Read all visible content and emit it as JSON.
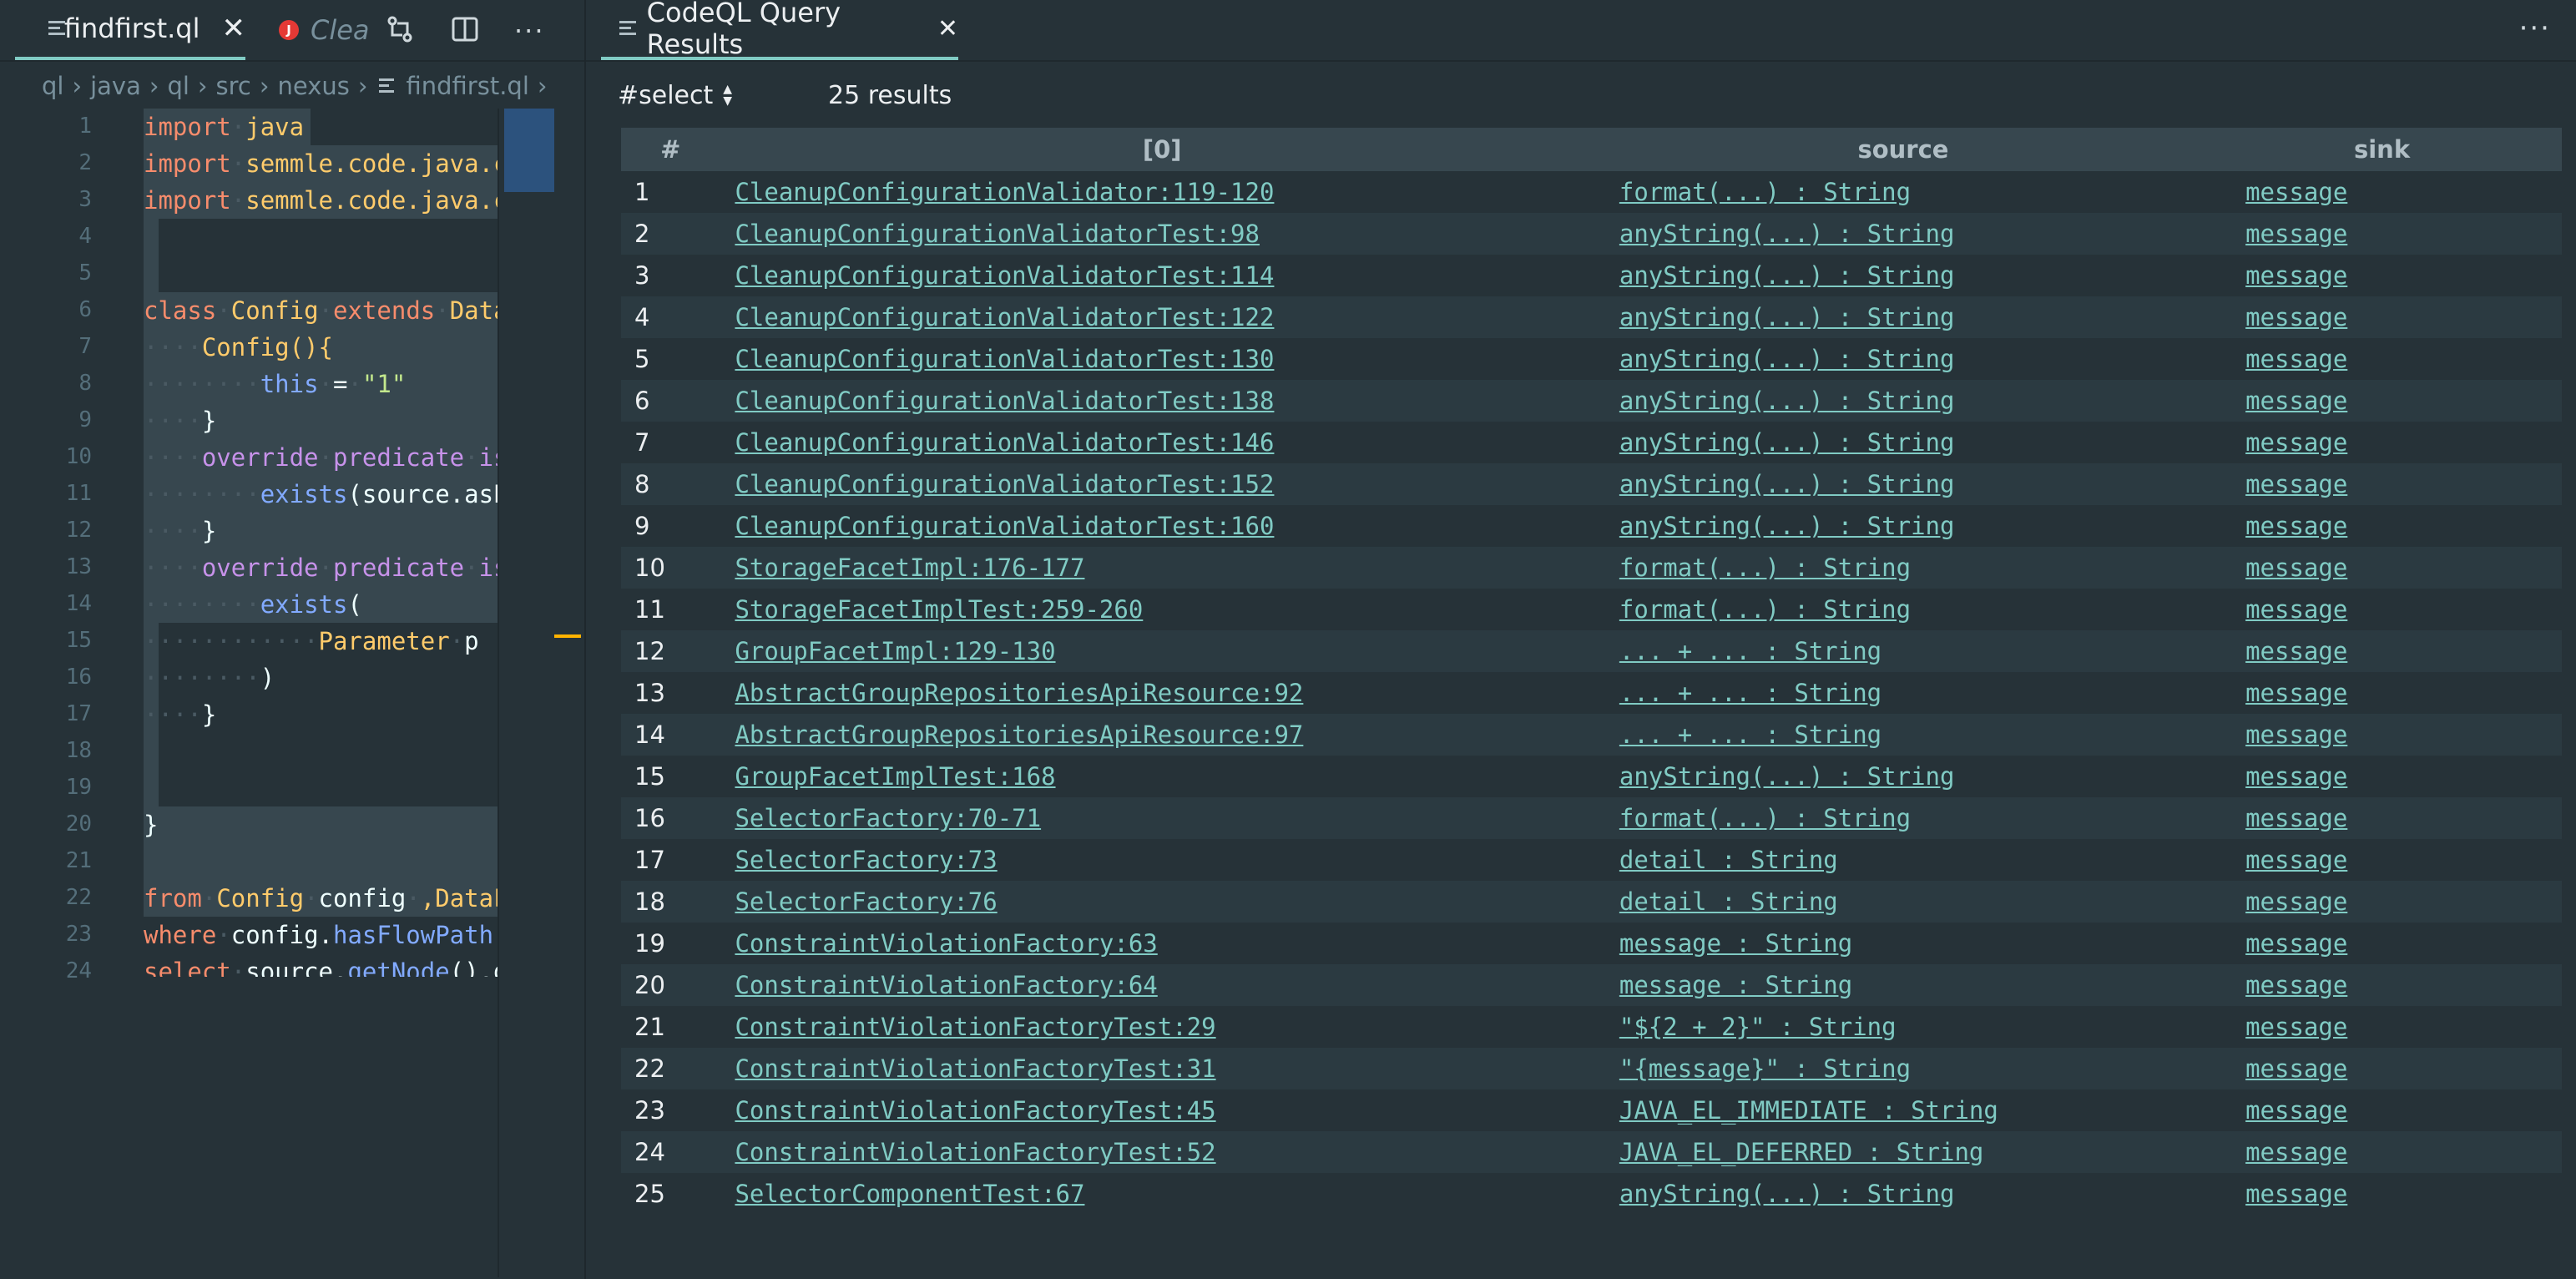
{
  "editor": {
    "tab_label": "findfirst.ql",
    "ghost_tab_label": "Clea",
    "breadcrumb": [
      "ql",
      "java",
      "ql",
      "src",
      "nexus",
      "findfirst.ql"
    ],
    "line_numbers": [
      "1",
      "2",
      "3",
      "4",
      "5",
      "6",
      "7",
      "8",
      "9",
      "10",
      "11",
      "12",
      "13",
      "14",
      "15",
      "16",
      "17",
      "18",
      "19",
      "20",
      "21",
      "22",
      "23",
      "24"
    ]
  },
  "results": {
    "tab_label": "CodeQL Query Results",
    "select_label": "#select",
    "count_label": "25 results",
    "columns": [
      "#",
      "[0]",
      "source",
      "sink"
    ],
    "rows": [
      {
        "n": "1",
        "col0": "CleanupConfigurationValidator:119-120",
        "source": "format(...) : String",
        "sink": "message"
      },
      {
        "n": "2",
        "col0": "CleanupConfigurationValidatorTest:98",
        "source": "anyString(...) : String",
        "sink": "message"
      },
      {
        "n": "3",
        "col0": "CleanupConfigurationValidatorTest:114",
        "source": "anyString(...) : String",
        "sink": "message"
      },
      {
        "n": "4",
        "col0": "CleanupConfigurationValidatorTest:122",
        "source": "anyString(...) : String",
        "sink": "message"
      },
      {
        "n": "5",
        "col0": "CleanupConfigurationValidatorTest:130",
        "source": "anyString(...) : String",
        "sink": "message"
      },
      {
        "n": "6",
        "col0": "CleanupConfigurationValidatorTest:138",
        "source": "anyString(...) : String",
        "sink": "message"
      },
      {
        "n": "7",
        "col0": "CleanupConfigurationValidatorTest:146",
        "source": "anyString(...) : String",
        "sink": "message"
      },
      {
        "n": "8",
        "col0": "CleanupConfigurationValidatorTest:152",
        "source": "anyString(...) : String",
        "sink": "message"
      },
      {
        "n": "9",
        "col0": "CleanupConfigurationValidatorTest:160",
        "source": "anyString(...) : String",
        "sink": "message"
      },
      {
        "n": "10",
        "col0": "StorageFacetImpl:176-177",
        "source": "format(...) : String",
        "sink": "message"
      },
      {
        "n": "11",
        "col0": "StorageFacetImplTest:259-260",
        "source": "format(...) : String",
        "sink": "message"
      },
      {
        "n": "12",
        "col0": "GroupFacetImpl:129-130",
        "source": "... + ... : String",
        "sink": "message"
      },
      {
        "n": "13",
        "col0": "AbstractGroupRepositoriesApiResource:92",
        "source": "... + ... : String",
        "sink": "message"
      },
      {
        "n": "14",
        "col0": "AbstractGroupRepositoriesApiResource:97",
        "source": "... + ... : String",
        "sink": "message"
      },
      {
        "n": "15",
        "col0": "GroupFacetImplTest:168",
        "source": "anyString(...) : String",
        "sink": "message"
      },
      {
        "n": "16",
        "col0": "SelectorFactory:70-71",
        "source": "format(...) : String",
        "sink": "message"
      },
      {
        "n": "17",
        "col0": "SelectorFactory:73",
        "source": "detail : String",
        "sink": "message"
      },
      {
        "n": "18",
        "col0": "SelectorFactory:76",
        "source": "detail : String",
        "sink": "message"
      },
      {
        "n": "19",
        "col0": "ConstraintViolationFactory:63",
        "source": "message : String",
        "sink": "message"
      },
      {
        "n": "20",
        "col0": "ConstraintViolationFactory:64",
        "source": "message : String",
        "sink": "message"
      },
      {
        "n": "21",
        "col0": "ConstraintViolationFactoryTest:29",
        "source": "\"${2 + 2}\" : String",
        "sink": "message"
      },
      {
        "n": "22",
        "col0": "ConstraintViolationFactoryTest:31",
        "source": "\"{message}\" : String",
        "sink": "message"
      },
      {
        "n": "23",
        "col0": "ConstraintViolationFactoryTest:45",
        "source": "JAVA_EL_IMMEDIATE : String",
        "sink": "message"
      },
      {
        "n": "24",
        "col0": "ConstraintViolationFactoryTest:52",
        "source": "JAVA_EL_DEFERRED : String",
        "sink": "message"
      },
      {
        "n": "25",
        "col0": "SelectorComponentTest:67",
        "source": "anyString(...) : String",
        "sink": "message"
      }
    ]
  },
  "code": {
    "l1": [
      "import",
      "java"
    ],
    "l2": [
      "import",
      "semmle.code.java.c"
    ],
    "l3": [
      "import",
      "semmle.code.java.c"
    ],
    "l6": [
      "class",
      "Config",
      "extends",
      "Data"
    ],
    "l7": "Config(){",
    "l8": [
      "this",
      "=",
      "\"1\""
    ],
    "l9": "}",
    "l10": [
      "override",
      "predicate",
      "is"
    ],
    "l11": [
      "exists",
      "(source.asE"
    ],
    "l12": "}",
    "l13": [
      "override",
      "predicate",
      "is"
    ],
    "l14": [
      "exists",
      "("
    ],
    "l15": [
      "Parameter",
      "p"
    ],
    "l16": ")",
    "l17": "}",
    "l20": "}",
    "l22": [
      "from",
      "Config",
      "config",
      ",DataF"
    ],
    "l23": [
      "where",
      "config.",
      "hasFlowPath("
    ],
    "l24": [
      "select",
      "source.",
      "getNode",
      "().g"
    ]
  }
}
